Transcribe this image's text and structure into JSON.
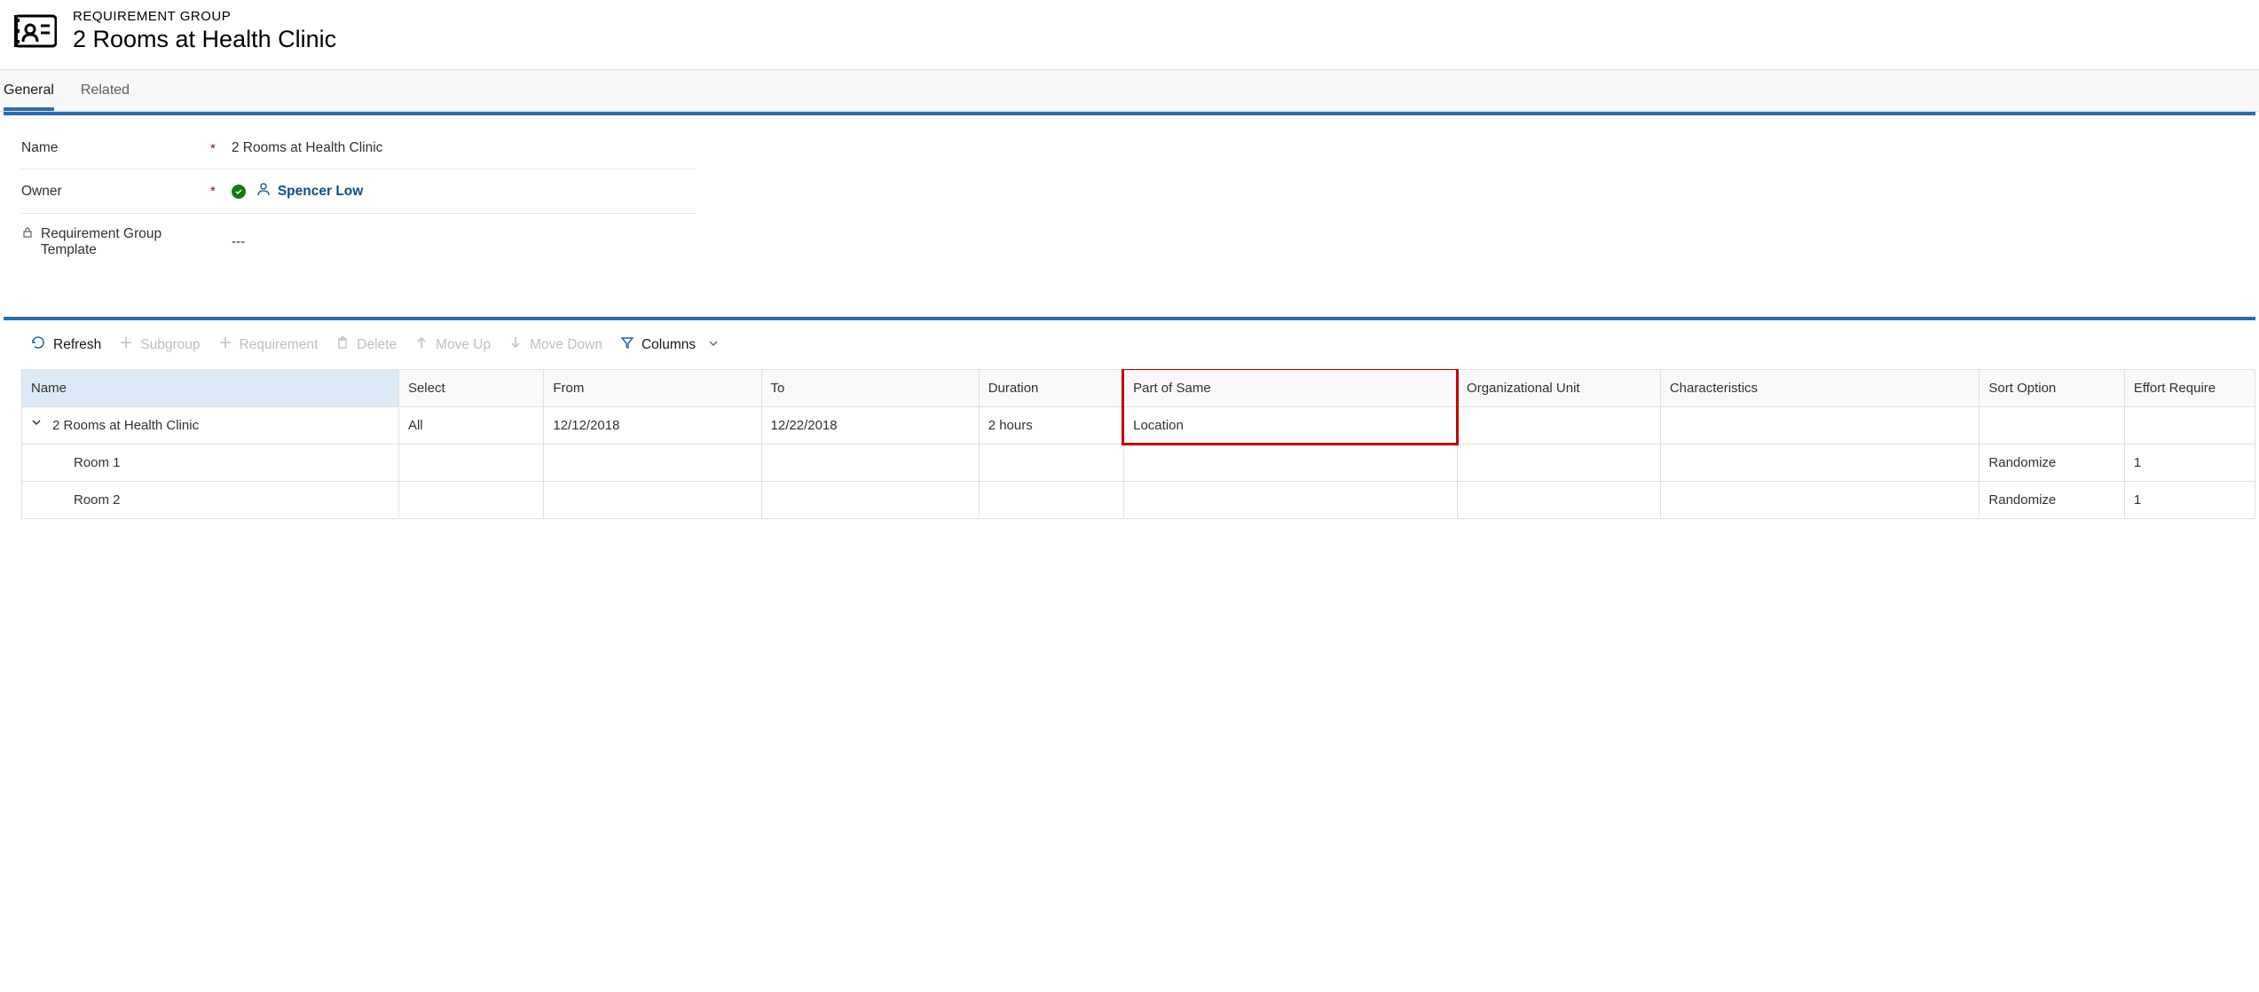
{
  "header": {
    "label": "REQUIREMENT GROUP",
    "title": "2 Rooms at Health Clinic"
  },
  "tabs": {
    "general": "General",
    "related": "Related"
  },
  "form": {
    "name_label": "Name",
    "name_value": "2 Rooms at Health Clinic",
    "owner_label": "Owner",
    "owner_value": "Spencer Low",
    "template_label": "Requirement Group Template",
    "template_value": "---"
  },
  "toolbar": {
    "refresh": "Refresh",
    "subgroup": "Subgroup",
    "requirement": "Requirement",
    "delete": "Delete",
    "moveup": "Move Up",
    "movedown": "Move Down",
    "columns": "Columns"
  },
  "columns": {
    "name": "Name",
    "select": "Select",
    "from": "From",
    "to": "To",
    "duration": "Duration",
    "partofsame": "Part of Same",
    "orgunit": "Organizational Unit",
    "characteristics": "Characteristics",
    "sortoption": "Sort Option",
    "effort": "Effort Require"
  },
  "rows": [
    {
      "name": "2 Rooms at Health Clinic",
      "select": "All",
      "from": "12/12/2018",
      "to": "12/22/2018",
      "duration": "2 hours",
      "partofsame": "Location",
      "orgunit": "",
      "characteristics": "",
      "sortoption": "",
      "effort": ""
    },
    {
      "name": "Room 1",
      "select": "",
      "from": "",
      "to": "",
      "duration": "",
      "partofsame": "",
      "orgunit": "",
      "characteristics": "",
      "sortoption": "Randomize",
      "effort": "1"
    },
    {
      "name": "Room 2",
      "select": "",
      "from": "",
      "to": "",
      "duration": "",
      "partofsame": "",
      "orgunit": "",
      "characteristics": "",
      "sortoption": "Randomize",
      "effort": "1"
    }
  ]
}
